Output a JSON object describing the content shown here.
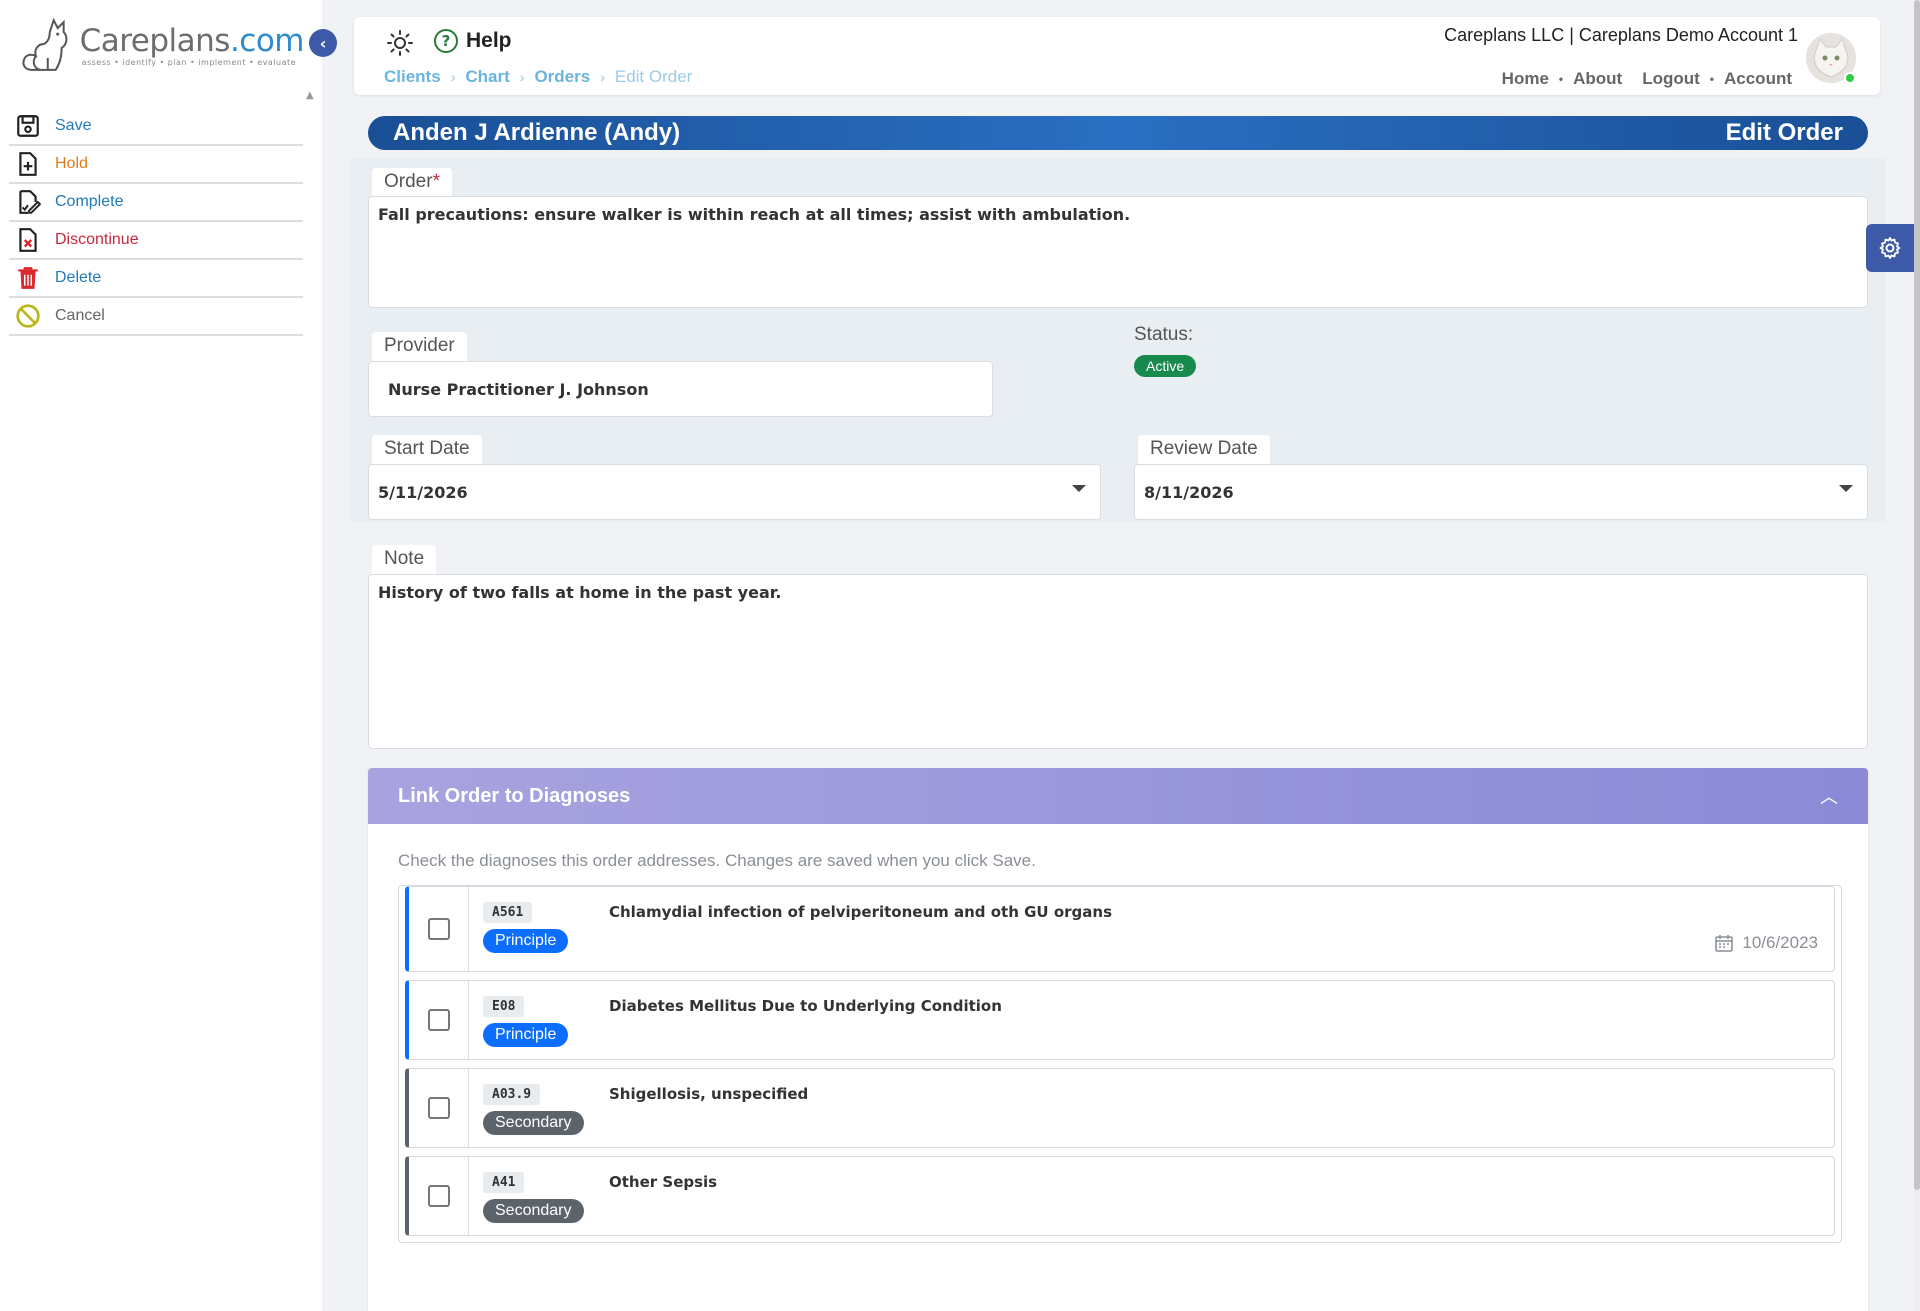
{
  "brand": {
    "name_a": "Care",
    "name_b": "plans",
    "name_c": ".com",
    "tagline": "assess • identify • plan • implement • evaluate"
  },
  "sidebar": {
    "actions": [
      {
        "label": "Save",
        "icon": "save-icon"
      },
      {
        "label": "Hold",
        "icon": "hold-file-icon"
      },
      {
        "label": "Complete",
        "icon": "complete-file-icon"
      },
      {
        "label": "Discontinue",
        "icon": "discontinue-file-icon"
      },
      {
        "label": "Delete",
        "icon": "trash-icon"
      },
      {
        "label": "Cancel",
        "icon": "cancel-icon"
      }
    ]
  },
  "header": {
    "help_label": "Help",
    "account_name": "Careplans LLC | Careplans Demo Account 1",
    "breadcrumb": [
      "Clients",
      "Chart",
      "Orders",
      "Edit Order"
    ],
    "nav": [
      "Home",
      "About",
      "Logout",
      "Account"
    ]
  },
  "page": {
    "patient_name": "Anden J Ardienne (Andy)",
    "title": "Edit Order"
  },
  "form": {
    "order_label": "Order",
    "order_required_mark": "*",
    "order_value": "Fall precautions: ensure walker is within reach at all times; assist with ambulation.",
    "provider_label": "Provider",
    "provider_value": "Nurse Practitioner J. Johnson",
    "status_label": "Status:",
    "status_value": "Active",
    "start_date_label": "Start Date",
    "start_date_value": "5/11/2026",
    "review_date_label": "Review Date",
    "review_date_value": "8/11/2026",
    "note_label": "Note",
    "note_value": "History of two falls at home in the past year."
  },
  "diagnoses": {
    "title": "Link Order to Diagnoses",
    "hint": "Check the diagnoses this order addresses. Changes are saved when you click Save.",
    "items": [
      {
        "code": "A561",
        "type": "Principle",
        "description": "Chlamydial infection of pelviperitoneum and oth GU organs",
        "date": "10/6/2023",
        "checked": false
      },
      {
        "code": "E08",
        "type": "Principle",
        "description": "Diabetes Mellitus Due to Underlying Condition",
        "checked": false
      },
      {
        "code": "A03.9",
        "type": "Secondary",
        "description": "Shigellosis, unspecified",
        "checked": false
      },
      {
        "code": "A41",
        "type": "Secondary",
        "description": "Other Sepsis",
        "checked": false
      }
    ]
  },
  "colors": {
    "primary": "#1a4f96",
    "principle_badge": "#0d6efd",
    "secondary_badge": "#5c636a",
    "status_active": "#198a4e",
    "diag_header": "#8a8ad6"
  }
}
